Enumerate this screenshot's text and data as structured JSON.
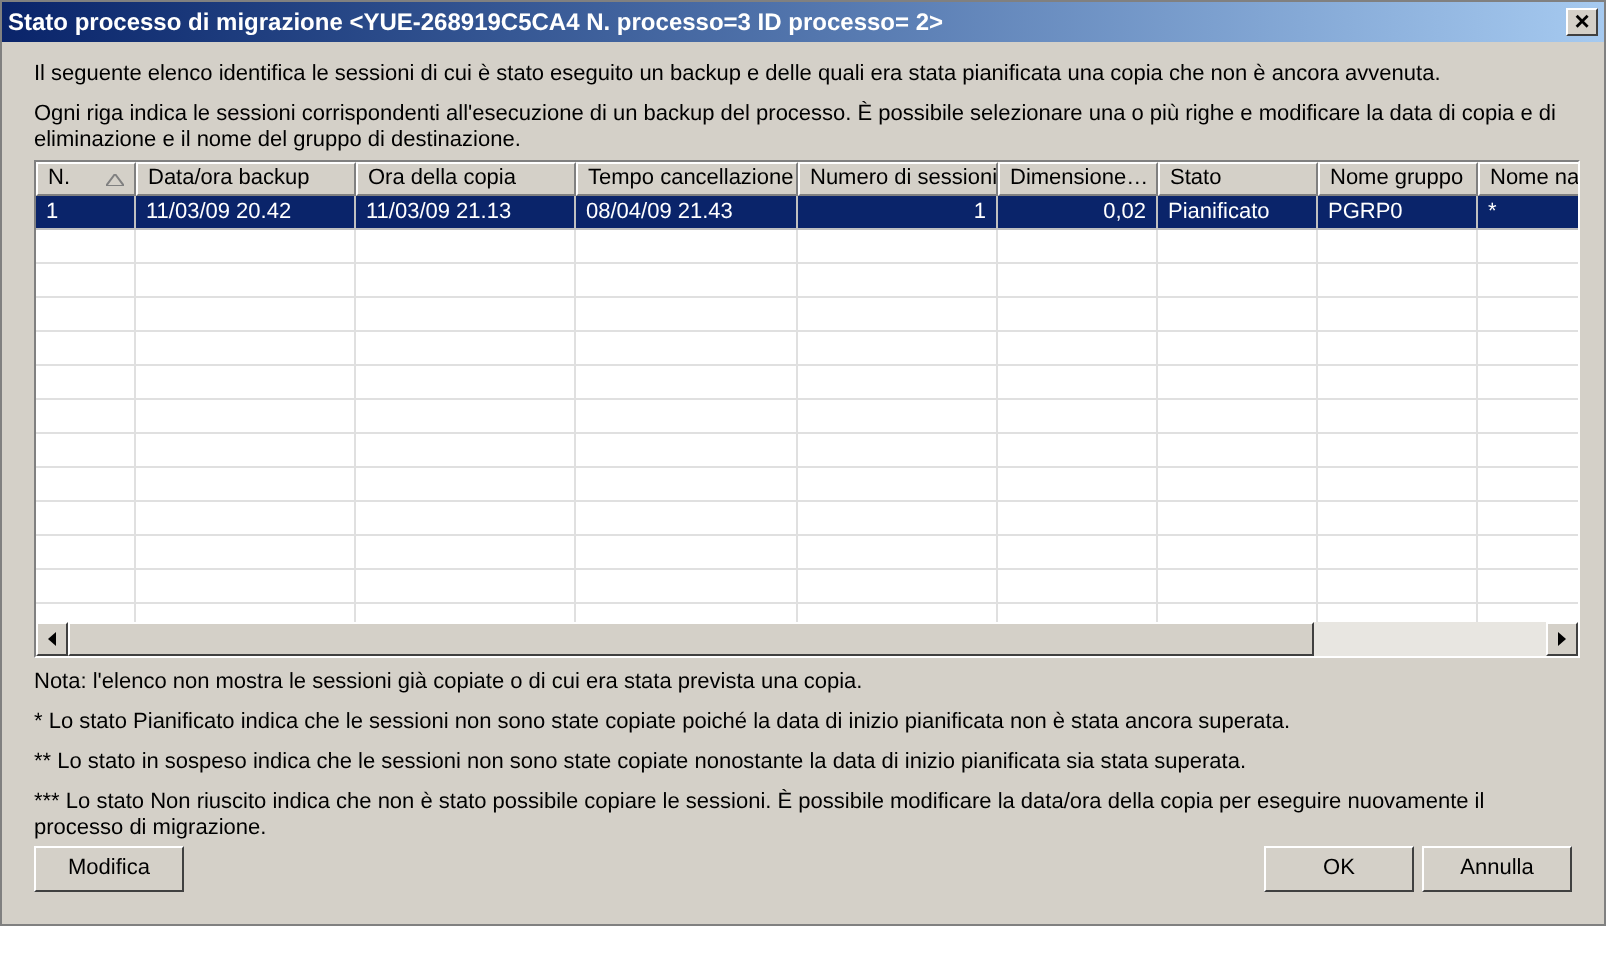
{
  "window": {
    "title": "Stato processo di migrazione <YUE-268919C5CA4 N. processo=3 ID processo= 2>",
    "close_glyph": "×"
  },
  "intro": [
    "Il seguente elenco identifica le sessioni di cui è stato eseguito un backup e delle quali era stata pianificata una copia che non è ancora avvenuta.",
    "Ogni riga indica le sessioni corrispondenti all'esecuzione di un backup del processo. È possibile selezionare una o più righe e modificare la data di copia e di eliminazione e il nome del gruppo di destinazione."
  ],
  "table": {
    "columns": [
      {
        "label": "N.",
        "sorted": true
      },
      {
        "label": "Data/ora backup",
        "sorted": false
      },
      {
        "label": "Ora della copia",
        "sorted": false
      },
      {
        "label": "Tempo cancellazione",
        "sorted": false
      },
      {
        "label": "Numero di sessioni",
        "sorted": false
      },
      {
        "label": "Dimensione…",
        "sorted": false
      },
      {
        "label": "Stato",
        "sorted": false
      },
      {
        "label": "Nome gruppo",
        "sorted": false
      },
      {
        "label": "Nome na",
        "sorted": false
      }
    ],
    "rows": [
      {
        "selected": true,
        "cells": [
          "1",
          "11/03/09  20.42",
          "11/03/09  21.13",
          "08/04/09  21.43",
          "1",
          "0,02",
          "Pianificato",
          "PGRP0",
          "*"
        ]
      }
    ]
  },
  "notes": [
    "Nota: l'elenco non mostra le sessioni già copiate o di cui era stata prevista una copia.",
    "*  Lo stato Pianificato indica che le sessioni non sono state copiate poiché la data di inizio pianificata non è stata ancora superata.",
    "** Lo stato in sospeso indica che le sessioni non sono state copiate nonostante la data di inizio pianificata sia stata superata.",
    "*** Lo stato Non riuscito indica che non è stato possibile copiare le sessioni. È possibile modificare la data/ora della copia per eseguire nuovamente il processo di migrazione."
  ],
  "buttons": {
    "left": [
      "Modifica"
    ],
    "right": [
      "OK",
      "Annulla"
    ]
  }
}
